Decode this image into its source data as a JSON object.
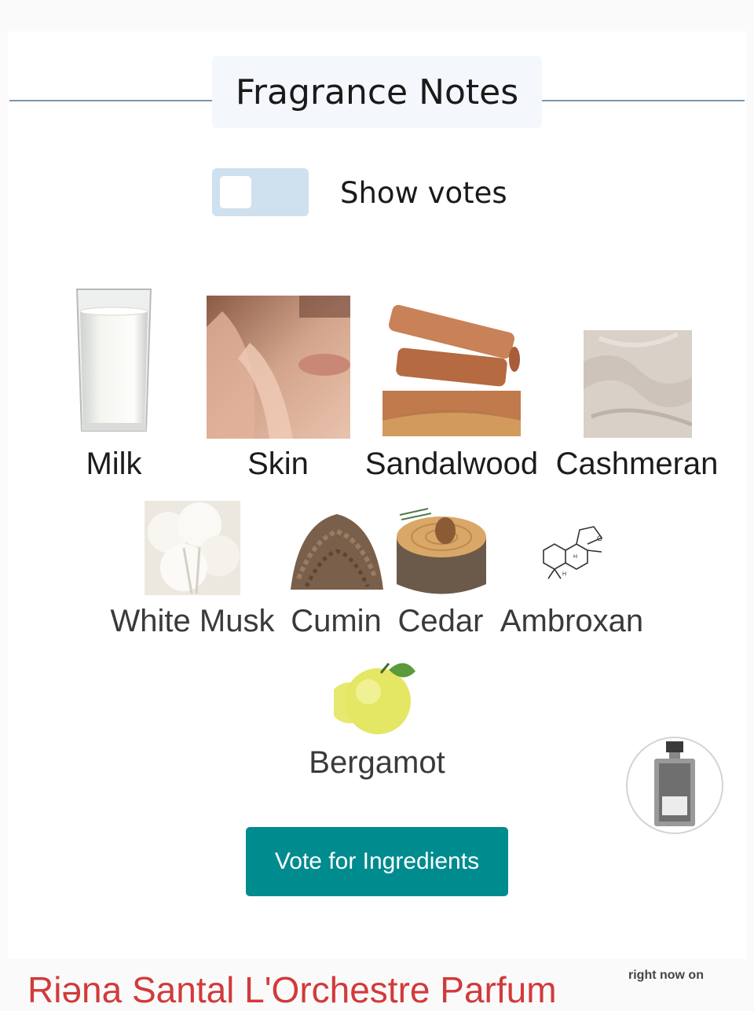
{
  "header": {
    "title": "Fragrance Notes"
  },
  "votes_toggle": {
    "label": "Show votes",
    "enabled": false
  },
  "notes": [
    {
      "name": "Milk",
      "icon": "milk-glass"
    },
    {
      "name": "Skin",
      "icon": "skin-face"
    },
    {
      "name": "Sandalwood",
      "icon": "sandalwood-logs"
    },
    {
      "name": "Cashmeran",
      "icon": "cashmere-fabric"
    },
    {
      "name": "White Musk",
      "icon": "white-fluff"
    },
    {
      "name": "Cumin",
      "icon": "cumin-seeds"
    },
    {
      "name": "Cedar",
      "icon": "cedar-stump"
    },
    {
      "name": "Ambroxan",
      "icon": "molecule-structure"
    },
    {
      "name": "Bergamot",
      "icon": "bergamot-fruit"
    }
  ],
  "vote_button": {
    "label": "Vote for Ingredients"
  },
  "footer": {
    "perfume_title": "Riəna Santal L'Orchestre Parfum",
    "ad_text": "right now on"
  },
  "colors": {
    "accent": "#008b8f",
    "toggle_track": "#cfe0ee",
    "divider": "#7d96ad",
    "footer_title": "#d23a3a"
  }
}
